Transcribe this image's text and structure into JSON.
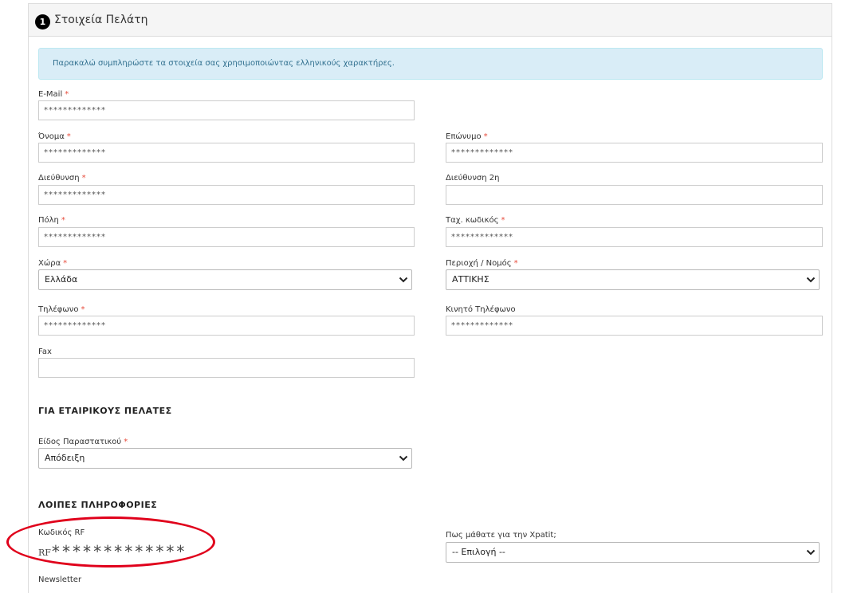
{
  "header": {
    "step_number": "1",
    "title": "Στοιχεία Πελάτη"
  },
  "alert_text": "Παρακαλώ συμπληρώστε τα στοιχεία σας χρησιμοποιώντας ελληνικούς χαρακτήρες.",
  "required_marker": "*",
  "fields": {
    "email": {
      "label": "E-Mail",
      "value": "*************"
    },
    "first_name": {
      "label": "Όνομα",
      "value": "*************"
    },
    "last_name": {
      "label": "Επώνυμο",
      "value": "*************"
    },
    "address": {
      "label": "Διεύθυνση",
      "value": "*************"
    },
    "address2": {
      "label": "Διεύθυνση 2η",
      "value": ""
    },
    "city": {
      "label": "Πόλη",
      "value": "*************"
    },
    "postal_code": {
      "label": "Ταχ. κωδικός",
      "value": "*************"
    },
    "country": {
      "label": "Χώρα",
      "value": "Ελλάδα"
    },
    "region": {
      "label": "Περιοχή / Νομός",
      "value": "ΑΤΤΙΚΗΣ"
    },
    "phone": {
      "label": "Τηλέφωνο",
      "value": "*************"
    },
    "mobile": {
      "label": "Κινητό Τηλέφωνο",
      "value": "*************"
    },
    "fax": {
      "label": "Fax",
      "value": ""
    }
  },
  "business": {
    "section_title": "ΓΙΑ ΕΤΑΙΡΙΚΟΥΣ ΠΕΛΑΤΕΣ",
    "document_type": {
      "label": "Είδος Παραστατικού",
      "value": "Απόδειξη"
    }
  },
  "other": {
    "section_title": "ΛΟΙΠΕΣ ΠΛΗΡΟΦΟΡΙΕΣ",
    "rf_code": {
      "label": "Κωδικός RF",
      "prefix": "RF",
      "value": "*************"
    },
    "referral": {
      "label": "Πως μάθατε για την Xpatit;",
      "value": "-- Επιλογή --"
    },
    "newsletter_label": "Newsletter"
  },
  "colors": {
    "required": "#e74c3c",
    "alert_bg": "#d9edf7",
    "annotation_ellipse": "#e0001b"
  }
}
